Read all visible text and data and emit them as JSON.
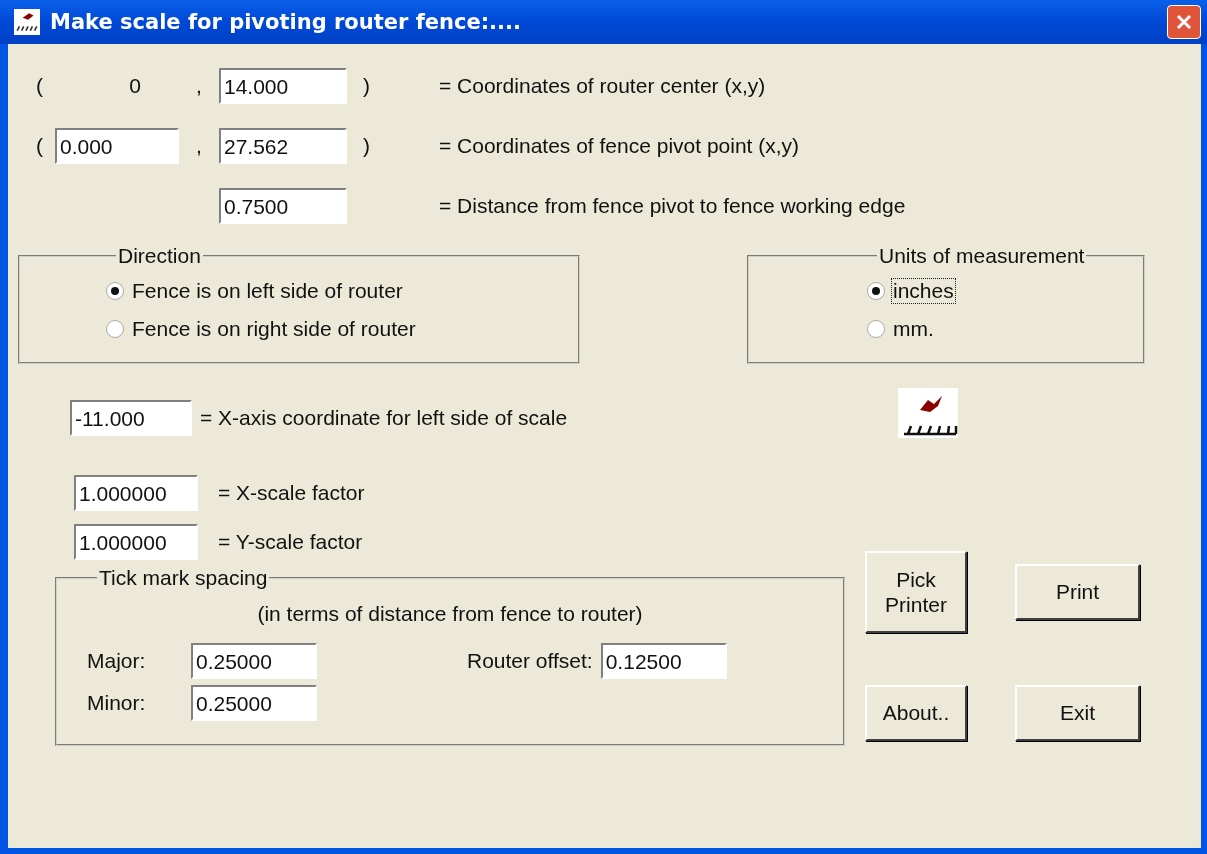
{
  "window": {
    "title": "Make scale for pivoting router fence:...."
  },
  "coordinate_rows": [
    {
      "open": "(",
      "x_text": "0",
      "comma": ",",
      "y_value": "14.000",
      "close": ")",
      "label": "= Coordinates of router center (x,y)"
    },
    {
      "open": "(",
      "x_value": "0.000",
      "comma": ",",
      "y_value": "27.562",
      "close": ")",
      "label": "= Coordinates of fence pivot point (x,y)"
    },
    {
      "y_value": "0.7500",
      "label": "= Distance from fence pivot to fence working edge"
    }
  ],
  "direction": {
    "title": "Direction",
    "options": [
      {
        "label": "Fence is on left side of router",
        "selected": true,
        "focused": false
      },
      {
        "label": "Fence is on right side of router",
        "selected": false,
        "focused": false
      }
    ]
  },
  "units": {
    "title": "Units of measurement",
    "options": [
      {
        "label": "inches",
        "selected": true,
        "focused": true
      },
      {
        "label": "mm.",
        "selected": false,
        "focused": false
      }
    ]
  },
  "x_axis": {
    "value": "-11.000",
    "label": "= X-axis coordinate for left side of scale"
  },
  "scale_factors": [
    {
      "value": "1.000000",
      "label": "= X-scale factor"
    },
    {
      "value": "1.000000",
      "label": "= Y-scale factor"
    }
  ],
  "tick_spacing": {
    "title": "Tick mark spacing",
    "note": "(in terms of distance from fence to router)",
    "major": {
      "label": "Major:",
      "value": "0.25000"
    },
    "minor": {
      "label": "Minor:",
      "value": "0.25000"
    },
    "router_offset": {
      "label": "Router offset:",
      "value": "0.12500"
    }
  },
  "buttons": [
    {
      "label": "Pick Printer"
    },
    {
      "label": "Print"
    },
    {
      "label": "About.."
    },
    {
      "label": "Exit"
    }
  ]
}
